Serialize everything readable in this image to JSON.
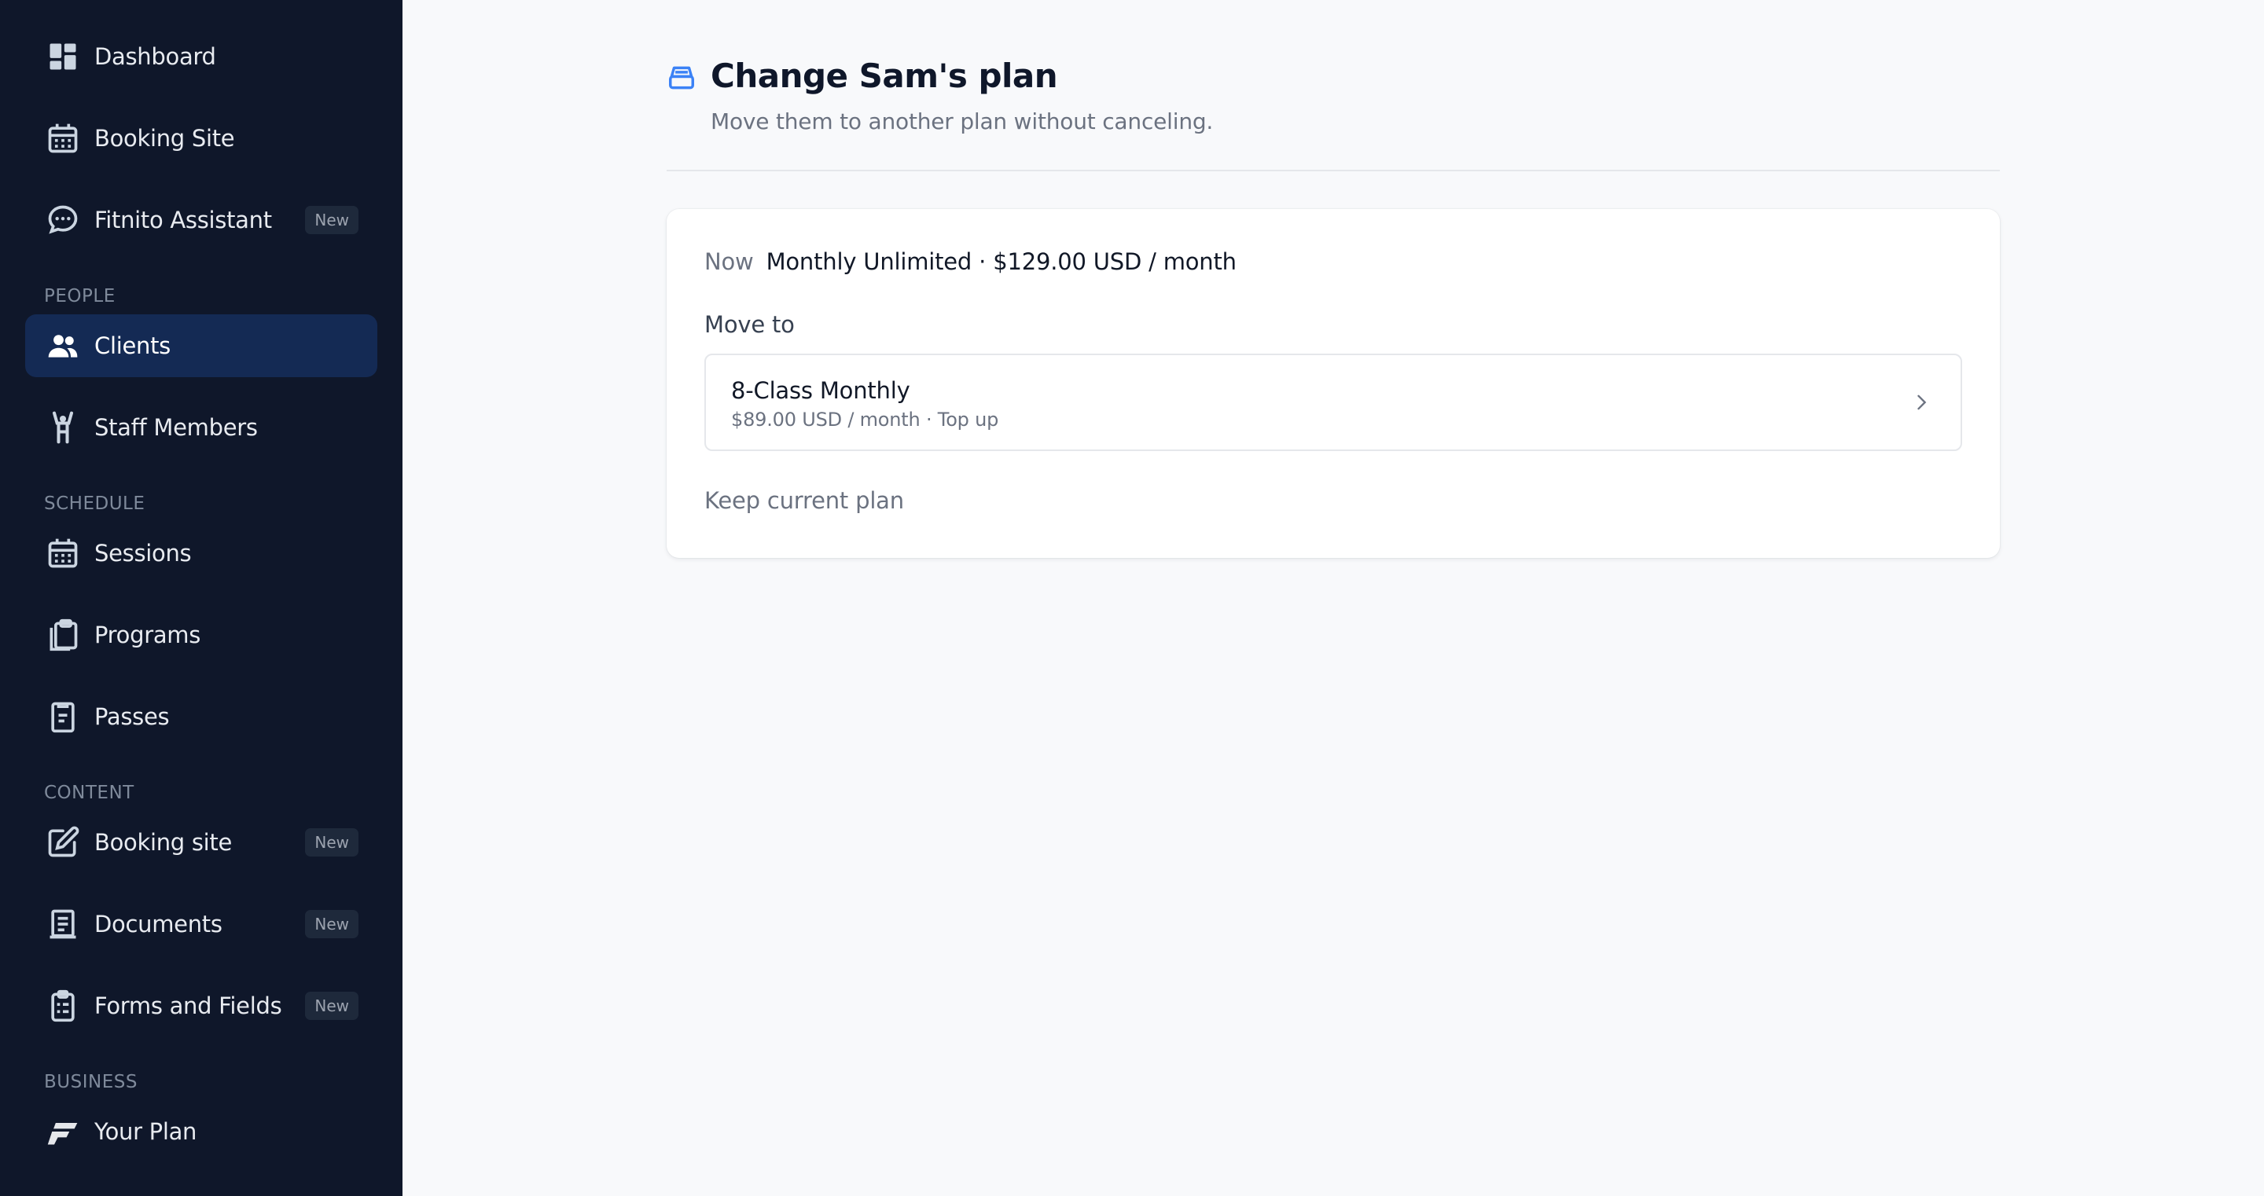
{
  "sidebar": {
    "items": [
      {
        "label": "Dashboard",
        "icon": "dashboard-icon"
      },
      {
        "label": "Booking Site",
        "icon": "calendar-icon"
      },
      {
        "label": "Fitnito Assistant",
        "icon": "chat-bubble-icon",
        "badge": "New"
      },
      {
        "label": "Clients",
        "icon": "users-icon",
        "active": true
      },
      {
        "label": "Staff Members",
        "icon": "person-arms-up-icon"
      },
      {
        "label": "Sessions",
        "icon": "calendar-icon"
      },
      {
        "label": "Programs",
        "icon": "clipboard-stack-icon"
      },
      {
        "label": "Passes",
        "icon": "pass-card-icon"
      },
      {
        "label": "Booking site",
        "icon": "edit-square-icon",
        "badge": "New"
      },
      {
        "label": "Documents",
        "icon": "document-icon",
        "badge": "New"
      },
      {
        "label": "Forms and Fields",
        "icon": "form-clipboard-icon",
        "badge": "New"
      },
      {
        "label": "Your Plan",
        "icon": "brand-logo-icon"
      }
    ],
    "sections": {
      "people": "PEOPLE",
      "schedule": "SCHEDULE",
      "content": "CONTENT",
      "business": "BUSINESS"
    }
  },
  "header": {
    "title": "Change Sam's plan",
    "subtitle": "Move them to another plan without canceling.",
    "icon": "archive-box-icon"
  },
  "card": {
    "now_label": "Now",
    "now_value": "Monthly Unlimited · $129.00 USD / month",
    "move_to_label": "Move to",
    "option": {
      "name": "8-Class Monthly",
      "details": "$89.00 USD / month · Top up"
    },
    "keep_label": "Keep current plan"
  },
  "colors": {
    "sidebar_bg": "#0f172a",
    "active_item_bg": "#142a54",
    "accent": "#3b82f6",
    "page_bg": "#f8f9fb"
  }
}
